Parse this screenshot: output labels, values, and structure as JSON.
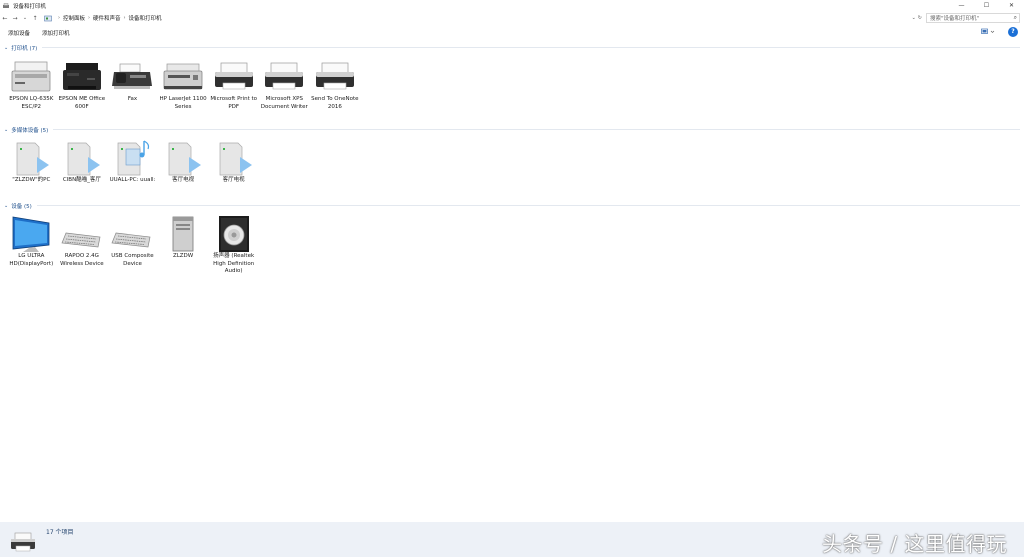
{
  "window": {
    "title": "设备和打印机",
    "controls": {
      "minimize": "—",
      "maximize": "☐",
      "close": "✕"
    }
  },
  "nav": {
    "back": "←",
    "forward": "→",
    "recent": "⌄",
    "up": "↑",
    "breadcrumb": [
      "控制面板",
      "硬件和声音",
      "设备和打印机"
    ],
    "refresh": "↻",
    "search_placeholder": "搜索\"设备和打印机\""
  },
  "commands": {
    "add_device": "添加设备",
    "add_printer": "添加打印机"
  },
  "groups": {
    "printers": {
      "title": "打印机 (7)",
      "items": [
        {
          "label": "EPSON LQ-635K ESC/P2",
          "icon": "dot-matrix-printer-icon"
        },
        {
          "label": "EPSON ME Office 600F",
          "icon": "inkjet-printer-icon"
        },
        {
          "label": "Fax",
          "icon": "fax-icon"
        },
        {
          "label": "HP LaserJet 1100 Series",
          "icon": "laser-printer-icon"
        },
        {
          "label": "Microsoft Print to PDF",
          "icon": "generic-printer-icon"
        },
        {
          "label": "Microsoft XPS Document Writer",
          "icon": "generic-printer-icon"
        },
        {
          "label": "Send To OneNote 2016",
          "icon": "generic-printer-icon"
        }
      ]
    },
    "multimedia": {
      "title": "多媒体设备 (5)",
      "items": [
        {
          "label": "\"ZLZDW\"的PC",
          "icon": "media-server-icon"
        },
        {
          "label": "CIBN酷喵_客厅",
          "icon": "media-server-icon"
        },
        {
          "label": "UUALL-PC: uuall:",
          "icon": "media-library-icon"
        },
        {
          "label": "客厅电视",
          "icon": "media-server-icon"
        },
        {
          "label": "客厅电视",
          "icon": "media-server-icon"
        }
      ]
    },
    "devices": {
      "title": "设备 (5)",
      "items": [
        {
          "label": "LG ULTRA HD(DisplayPort)",
          "icon": "monitor-icon"
        },
        {
          "label": "RAPOO 2.4G Wireless Device",
          "icon": "keyboard-icon"
        },
        {
          "label": "USB Composite Device",
          "icon": "keyboard-icon"
        },
        {
          "label": "ZLZDW",
          "icon": "computer-tower-icon"
        },
        {
          "label": "扬声器 (Realtek High Definition Audio)",
          "icon": "speaker-icon"
        }
      ]
    }
  },
  "status": {
    "count": "17 个项目"
  },
  "watermark": "头条号 / 这里值得玩",
  "colors": {
    "group_title": "#1e4f8c",
    "status_bg": "#edf1f7",
    "accent": "#1a6fd6"
  }
}
